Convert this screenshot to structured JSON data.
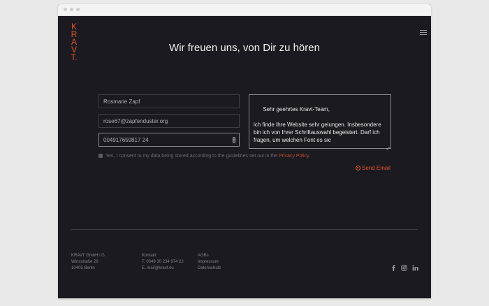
{
  "brand": {
    "logo_letters": [
      "K",
      "R",
      "A",
      "V",
      "T."
    ]
  },
  "heading": "Wir freuen uns, von Dir zu hören",
  "form": {
    "name_value": "Rosmarie Zapf",
    "email_value": "rose67@zapfenduster.org",
    "phone_value": "004917659817 24",
    "message_value": "Sehr geehrtes Kravt-Team,\n\nich finde Ihre Website sehr gelungen. Insbesondere bin ich von Ihrer Schriftauswahl begeistert. Darf ich fragen, um welchen Font es sic",
    "consent_text": "Yes, I consent to my data being stored according to the guidelines set out in the ",
    "consent_link": "Privacy Policy",
    "consent_end": ".",
    "send_label": "Send Email"
  },
  "footer": {
    "company": [
      "KRAVT GmbH i.G.",
      "Winsstraße 26",
      "10405 Berlin"
    ],
    "contact": [
      "Kontakt",
      "T. 0049 30 234 974 22",
      "E. mail@kravt.eu"
    ],
    "legal": [
      "AGBs",
      "Impressum",
      "Datenschutz"
    ]
  },
  "icons": {
    "menu": "hamburger-icon",
    "send": "arrow-circle-icon",
    "social": [
      "facebook-icon",
      "instagram-icon",
      "linkedin-icon"
    ]
  },
  "colors": {
    "accent": "#e0532f",
    "background": "#1b1a20",
    "text": "#f2f2f2"
  }
}
